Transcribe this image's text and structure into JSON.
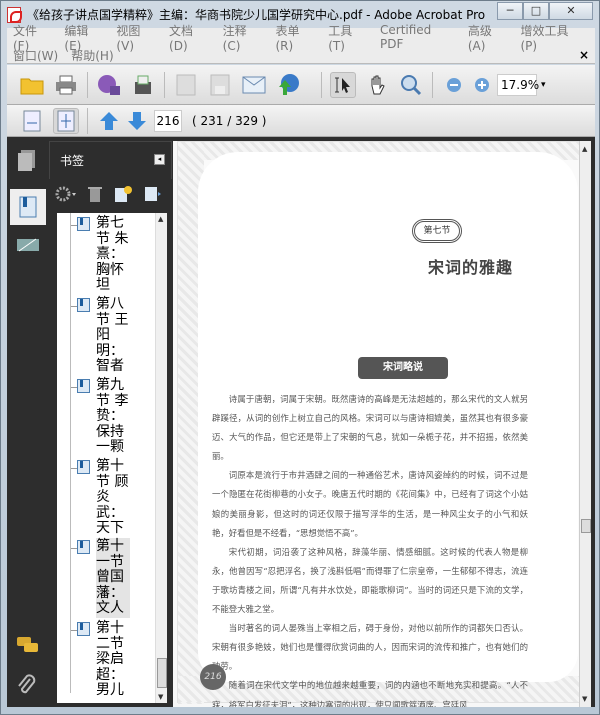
{
  "window": {
    "title": "《给孩子讲点国学精粹》主编：华商书院少儿国学研究中心.pdf - Adobe Acrobat Pro",
    "minimize": "─",
    "maximize": "□",
    "close": "✕"
  },
  "menu": {
    "row1": [
      "文件(F)",
      "编辑(E)",
      "视图(V)",
      "文档(D)",
      "注释(C)",
      "表单(R)",
      "工具(T)",
      "Certified PDF",
      "高级(A)",
      "增效工具(P)"
    ],
    "row2": [
      "窗口(W)",
      "帮助(H)"
    ],
    "close": "×"
  },
  "toolbar": {
    "zoom": "17.9%",
    "zoom_dropdown": "▾"
  },
  "nav": {
    "page_input": "216",
    "page_count": "( 231 / 329 )"
  },
  "bookmarks": {
    "title": "书签",
    "collapse": "◂",
    "items": [
      {
        "label": "第七节 朱熹：胸怀坦"
      },
      {
        "label": "第八节 王阳明：智者"
      },
      {
        "label": "第九节 李贽：保持一颗"
      },
      {
        "label": "第十节 顾炎武：天下"
      },
      {
        "label": "第十一节曾国藩：文人",
        "selected": true
      },
      {
        "label": "第十二节梁启超：男儿"
      }
    ]
  },
  "page": {
    "section_badge": "第七节",
    "section_title": "宋词的雅趣",
    "banner": "宋词略说",
    "paragraphs": [
      "诗属于唐朝，词属于宋朝。既然唐诗的高峰是无法超越的，那么宋代的文人就另辟蹊径，从词的创作上树立自己的风格。宋词可以与唐诗相媲美，虽然其也有很多豪迈、大气的作品，但它还是带上了宋朝的气息，犹如一朵栀子花，并不招摇，依然美丽。",
      "词原本是流行于市井酒肆之间的一种通俗艺术，唐诗风姿绰约的时候，词不过是一个隐匿在花街柳巷的小女子。晚唐五代时期的《花间集》中，已经有了词这个小姑娘的美丽身影，但这时的词还仅限于描写浮华的生活，是一种风尘女子的小气和妖艳，好看但是不经看，“思想觉悟不高”。",
      "宋代初期，词沿袭了这种风格，辞藻华丽、情感细腻。这时候的代表人物是柳永，他曾因写“忍把浮名，换了浅斟低唱”而得罪了仁宗皇帝，一生郁郁不得志，流连于歌坊青楼之间，所谓“凡有井水饮处，即能歌柳词”。当时的词还只是下流的文学，不能登大雅之堂。",
      "当时著名的词人晏殊当上宰相之后，碍于身份，对他以前所作的词都矢口否认。宋朝有很多艳妓，她们也是懂得欣赏词曲的人，因而宋词的流传和推广，也有她们的功劳。",
      "随着词在宋代文学中的地位越来越重要，词的内涵也不断地充实和提高。“人不寐，将军白发征夫泪”，这种边塞词的出现，使只闻歌筵酒席、宫廷风"
    ],
    "page_number": "216"
  }
}
